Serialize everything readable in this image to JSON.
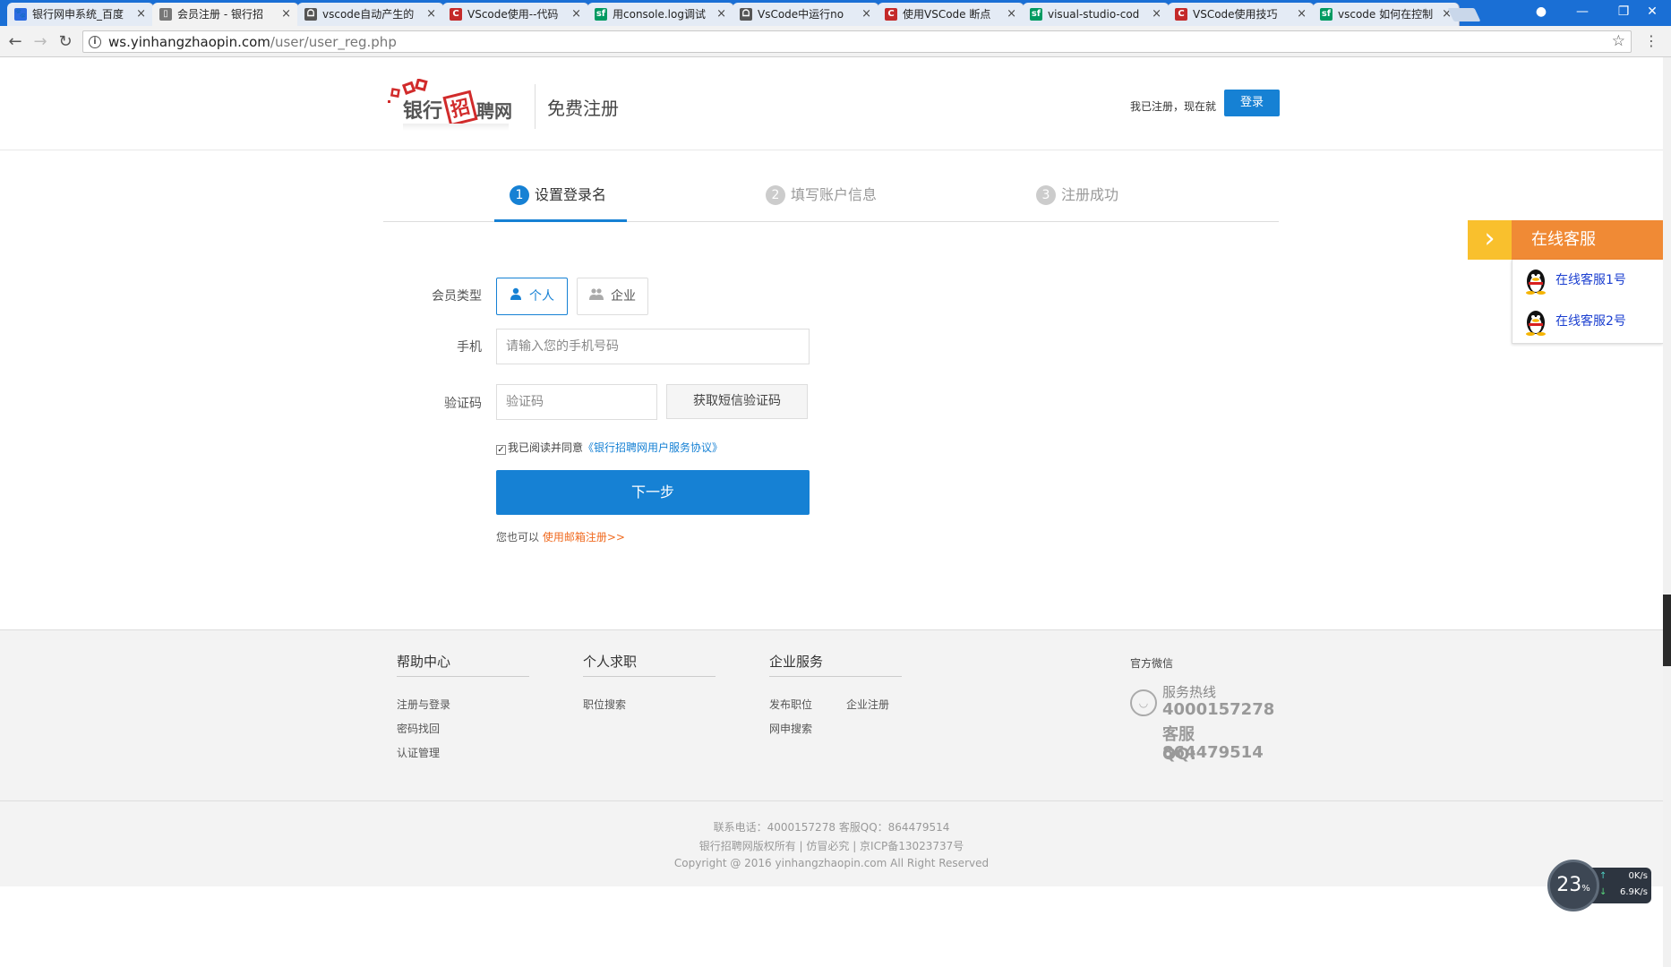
{
  "browser": {
    "tabs": [
      {
        "title": "银行网申系统_百度",
        "favicon": "baidu-paw",
        "color": "#2b6be0",
        "glyph": "🐾"
      },
      {
        "title": "会员注册 - 银行招",
        "favicon": "page",
        "color": "#777777",
        "glyph": "▯"
      },
      {
        "title": "vscode自动产生的",
        "favicon": "community",
        "color": "#555555",
        "glyph": "ᗝ"
      },
      {
        "title": "VScode使用--代码",
        "favicon": "csdn",
        "color": "#c42a2a",
        "glyph": "C"
      },
      {
        "title": "用console.log调试",
        "favicon": "segmentfault",
        "color": "#009a61",
        "glyph": "sf"
      },
      {
        "title": "VsCode中运行no",
        "favicon": "community",
        "color": "#555555",
        "glyph": "ᗝ"
      },
      {
        "title": "使用VSCode 断点",
        "favicon": "csdn",
        "color": "#c42a2a",
        "glyph": "C"
      },
      {
        "title": "visual-studio-cod",
        "favicon": "segmentfault",
        "color": "#009a61",
        "glyph": "sf"
      },
      {
        "title": "VSCode使用技巧",
        "favicon": "csdn",
        "color": "#c42a2a",
        "glyph": "C"
      },
      {
        "title": "vscode 如何在控制",
        "favicon": "segmentfault",
        "color": "#009a61",
        "glyph": "sf"
      }
    ],
    "url_host": "ws.yinhangzhaopin.com",
    "url_path": "/user/user_reg.php"
  },
  "header": {
    "logo": {
      "part1": "银行",
      "part2": "招",
      "part3": "聘网"
    },
    "title": "免费注册",
    "login_hint": "我已注册，现在就",
    "login_button": "登录"
  },
  "steps": [
    {
      "num": "1",
      "label": "设置登录名",
      "active": true
    },
    {
      "num": "2",
      "label": "填写账户信息",
      "active": false
    },
    {
      "num": "3",
      "label": "注册成功",
      "active": false
    }
  ],
  "form": {
    "member_type_label": "会员类型",
    "type_personal": "个人",
    "type_enterprise": "企业",
    "phone_label": "手机",
    "phone_placeholder": "请输入您的手机号码",
    "code_label": "验证码",
    "code_placeholder": "验证码",
    "sms_button": "获取短信验证码",
    "agree_checked": true,
    "agree_text": "我已阅读并同意",
    "agree_link": "《银行招聘网用户服务协议》",
    "next_button": "下一步",
    "alt_text": "您也可以",
    "alt_link": "使用邮箱注册>>"
  },
  "online_service": {
    "title": "在线客服",
    "items": [
      "在线客服1号",
      "在线客服2号"
    ]
  },
  "footer": {
    "columns": [
      {
        "title": "帮助中心",
        "links": [
          "注册与登录",
          "密码找回",
          "认证管理"
        ]
      },
      {
        "title": "个人求职",
        "links": [
          "职位搜索"
        ]
      },
      {
        "title": "企业服务",
        "links": [
          "发布职位",
          "企业注册",
          "网申搜索"
        ]
      }
    ],
    "wechat": "官方微信",
    "hotline_label": "服务热线",
    "hotline_number": "4000157278",
    "qq_label": "客服QQ:",
    "qq_number": "864479514",
    "contact": "联系电话：4000157278 客服QQ：864479514",
    "rights": "银行招聘网版权所有 | 仿冒必究 | 京ICP备13023737号",
    "copyright": "Copyright @ 2016 yinhangzhaopin.com All Right Reserved"
  },
  "speed_widget": {
    "percent": "23",
    "percent_unit": "%",
    "upload": "0K/s",
    "download": "6.9K/s"
  }
}
